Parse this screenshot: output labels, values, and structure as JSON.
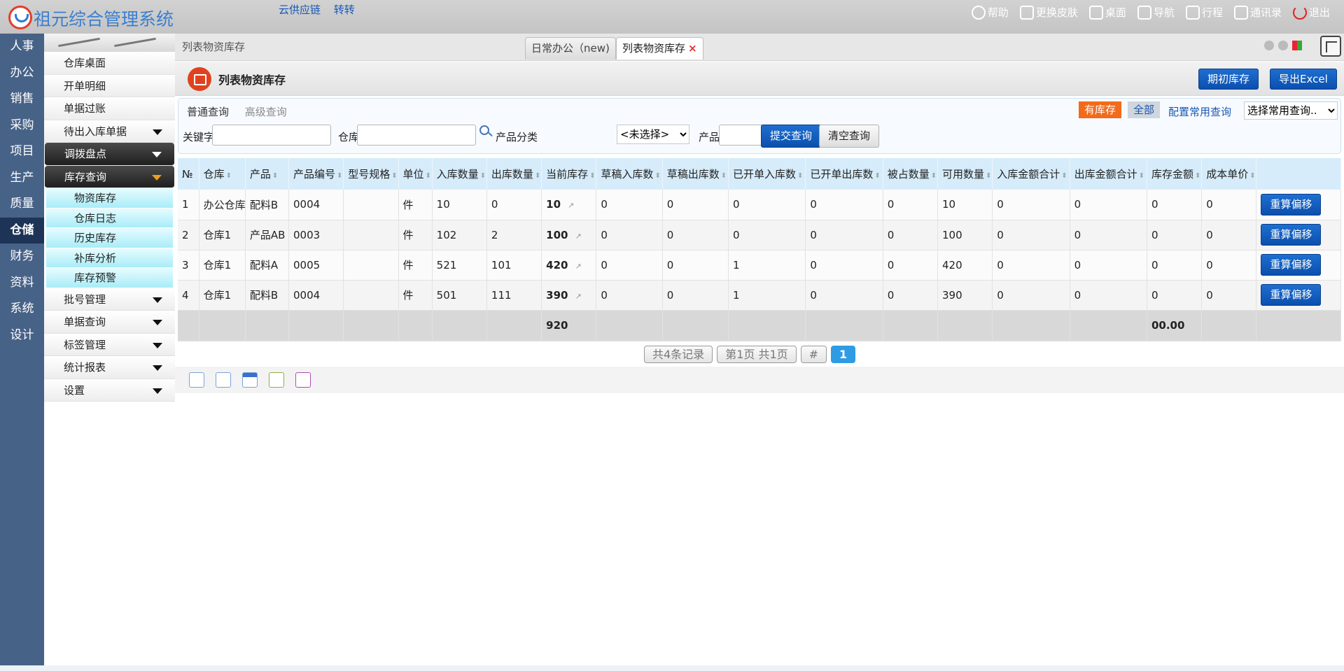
{
  "app": {
    "title": "祖元综合管理系统"
  },
  "top_links": [
    "云供应链",
    "转转"
  ],
  "top_menu": [
    {
      "label": "帮助",
      "icon": "help-icon"
    },
    {
      "label": "更换皮肤",
      "icon": "tshirt-icon"
    },
    {
      "label": "桌面",
      "icon": "home-icon"
    },
    {
      "label": "导航",
      "icon": "grid-icon"
    },
    {
      "label": "行程",
      "icon": "calendar-icon"
    },
    {
      "label": "通讯录",
      "icon": "contact-icon"
    },
    {
      "label": "退出",
      "icon": "power-icon"
    }
  ],
  "left_nav": [
    "人事",
    "办公",
    "销售",
    "采购",
    "项目",
    "生产",
    "质量",
    "仓储",
    "财务",
    "资料",
    "系统",
    "设计"
  ],
  "left_nav_active": "仓储",
  "sidebar": {
    "items": [
      "仓库桌面",
      "开单明细",
      "单据过账",
      "待出入库单据",
      "调拨盘点",
      "库存查询",
      "批号管理",
      "单据查询",
      "标签管理",
      "统计报表",
      "设置"
    ],
    "sub_items": [
      "物资库存",
      "仓库日志",
      "历史库存",
      "补库分析",
      "库存预警"
    ]
  },
  "tabs": {
    "breadcrumb": "列表物资库存",
    "items": [
      "日常办公（new)",
      "列表物资库存"
    ],
    "close_glyph": "×"
  },
  "header": {
    "title": "列表物资库存",
    "btn_initial": "期初库存",
    "btn_export": "导出Excel"
  },
  "query": {
    "tab_normal": "普通查询",
    "tab_advanced": "高级查询",
    "filter_stock": "有库存",
    "filter_all": "全部",
    "config": "配置常用查询",
    "common_select": "选择常用查询..",
    "keyword_label": "关键字",
    "warehouse_label": "仓库",
    "category_label": "产品分类",
    "category_value": "<未选择>",
    "product_label": "产品",
    "submit": "提交查询",
    "clear": "清空查询"
  },
  "table": {
    "headers": [
      "№",
      "仓库",
      "产品",
      "产品编号",
      "型号规格",
      "单位",
      "入库数量",
      "出库数量",
      "当前库存",
      "草稿入库数",
      "草稿出库数",
      "已开单入库数",
      "已开单出库数",
      "被占数量",
      "可用数量",
      "入库金额合计",
      "出库金额合计",
      "库存金额",
      "成本单价"
    ],
    "rows": [
      [
        "1",
        "办公仓库",
        "配料B",
        "0004",
        "",
        "件",
        "10",
        "0",
        "10",
        "0",
        "0",
        "0",
        "0",
        "0",
        "10",
        "0",
        "0",
        "0",
        "0"
      ],
      [
        "2",
        "仓库1",
        "产品AB",
        "0003",
        "",
        "件",
        "102",
        "2",
        "100",
        "0",
        "0",
        "0",
        "0",
        "0",
        "100",
        "0",
        "0",
        "0",
        "0"
      ],
      [
        "3",
        "仓库1",
        "配料A",
        "0005",
        "",
        "件",
        "521",
        "101",
        "420",
        "0",
        "0",
        "1",
        "0",
        "0",
        "420",
        "0",
        "0",
        "0",
        "0"
      ],
      [
        "4",
        "仓库1",
        "配料B",
        "0004",
        "",
        "件",
        "501",
        "111",
        "390",
        "0",
        "0",
        "1",
        "0",
        "0",
        "390",
        "0",
        "0",
        "0",
        "0"
      ]
    ],
    "row_action": "重算偏移",
    "totals": {
      "stock": "920",
      "amount": "00.00"
    }
  },
  "pager": {
    "records": "共4条记录",
    "pages": "第1页 共1页",
    "hash": "#",
    "current": "1"
  }
}
